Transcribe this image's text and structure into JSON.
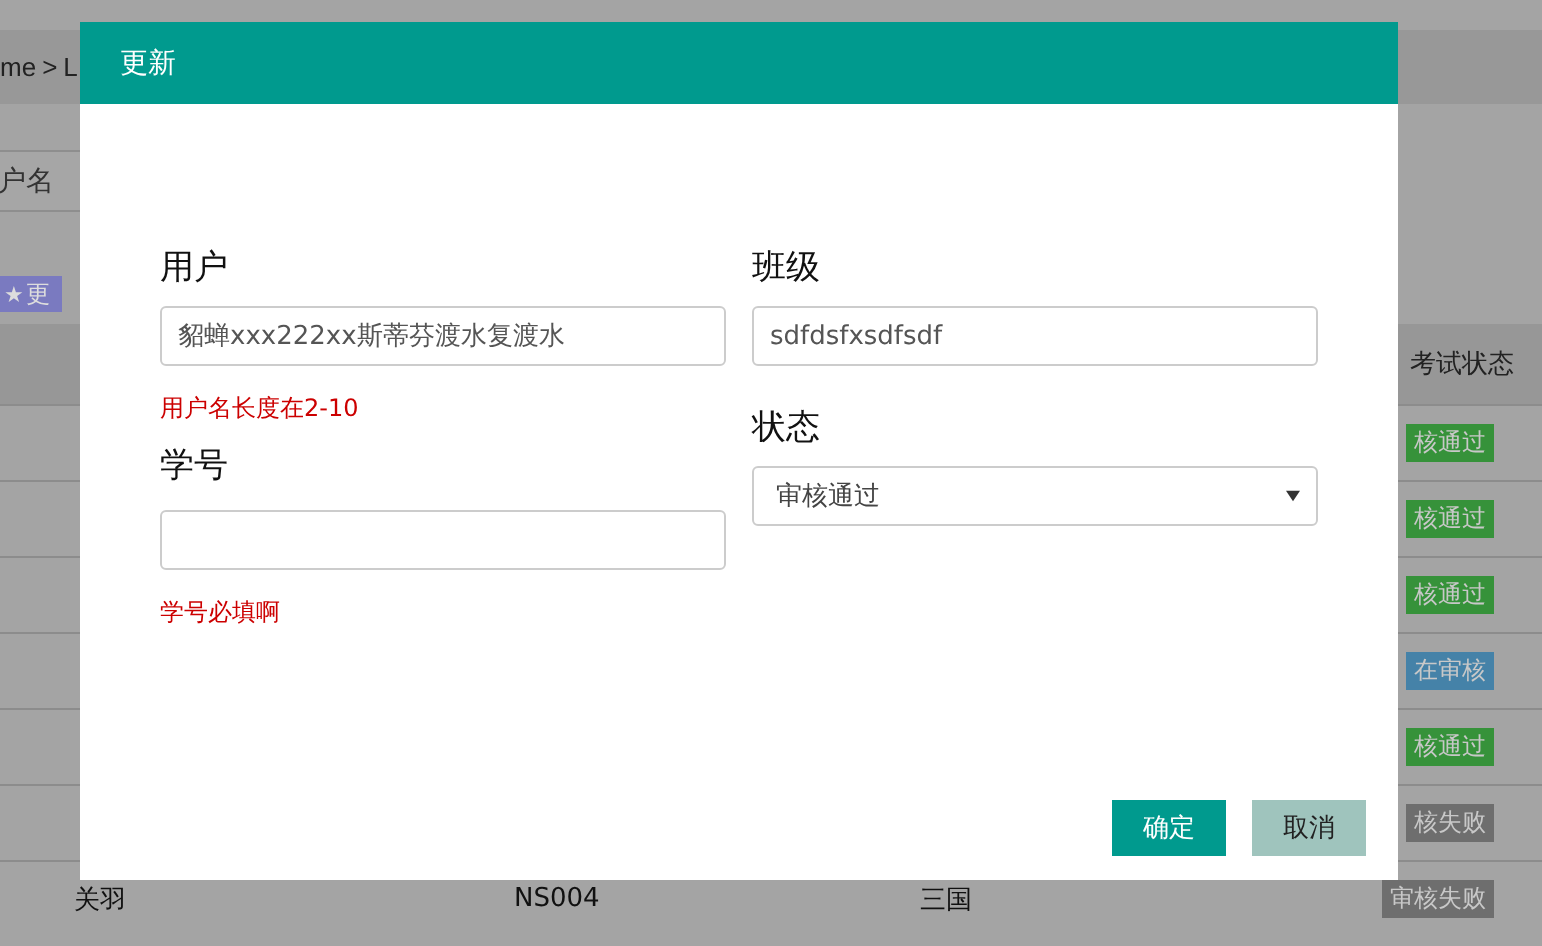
{
  "background_page": {
    "breadcrumb": [
      "me",
      ">",
      "L"
    ],
    "search": {
      "placeholder": "户名"
    },
    "update_button": {
      "icon": "★",
      "label": "更"
    },
    "table": {
      "columns": [
        "考试状态"
      ],
      "rows": [
        {
          "status": "核通过",
          "color": "#36923a"
        },
        {
          "status": "核通过",
          "color": "#36923a"
        },
        {
          "status": "核通过",
          "color": "#36923a"
        },
        {
          "status": "在审核",
          "color": "#4582a8"
        },
        {
          "status": "核通过",
          "color": "#36923a"
        },
        {
          "status": "核失败",
          "color": "#6e6e6e"
        },
        {
          "cells": [
            "关羽",
            "NS004",
            "三国"
          ],
          "status": "审核失败",
          "color": "#6e6e6e"
        }
      ]
    }
  },
  "dialog": {
    "title": "更新",
    "columns": [
      {
        "fields": [
          {
            "label": "用户",
            "kind": "text",
            "value": "貂蝉xxx222xx斯蒂芬渡水复渡水",
            "error": "用户名长度在2-10"
          },
          {
            "label": "学号",
            "kind": "text",
            "error": "学号必填啊"
          }
        ]
      },
      {
        "fields": [
          {
            "label": "班级",
            "kind": "text",
            "value": "sdfdsfxsdfsdf"
          },
          {
            "label": "状态",
            "kind": "select",
            "value": "审核通过"
          }
        ]
      }
    ],
    "buttons": [
      {
        "label": "确定",
        "kind": "primary"
      },
      {
        "label": "取消",
        "kind": "secondary"
      }
    ]
  }
}
